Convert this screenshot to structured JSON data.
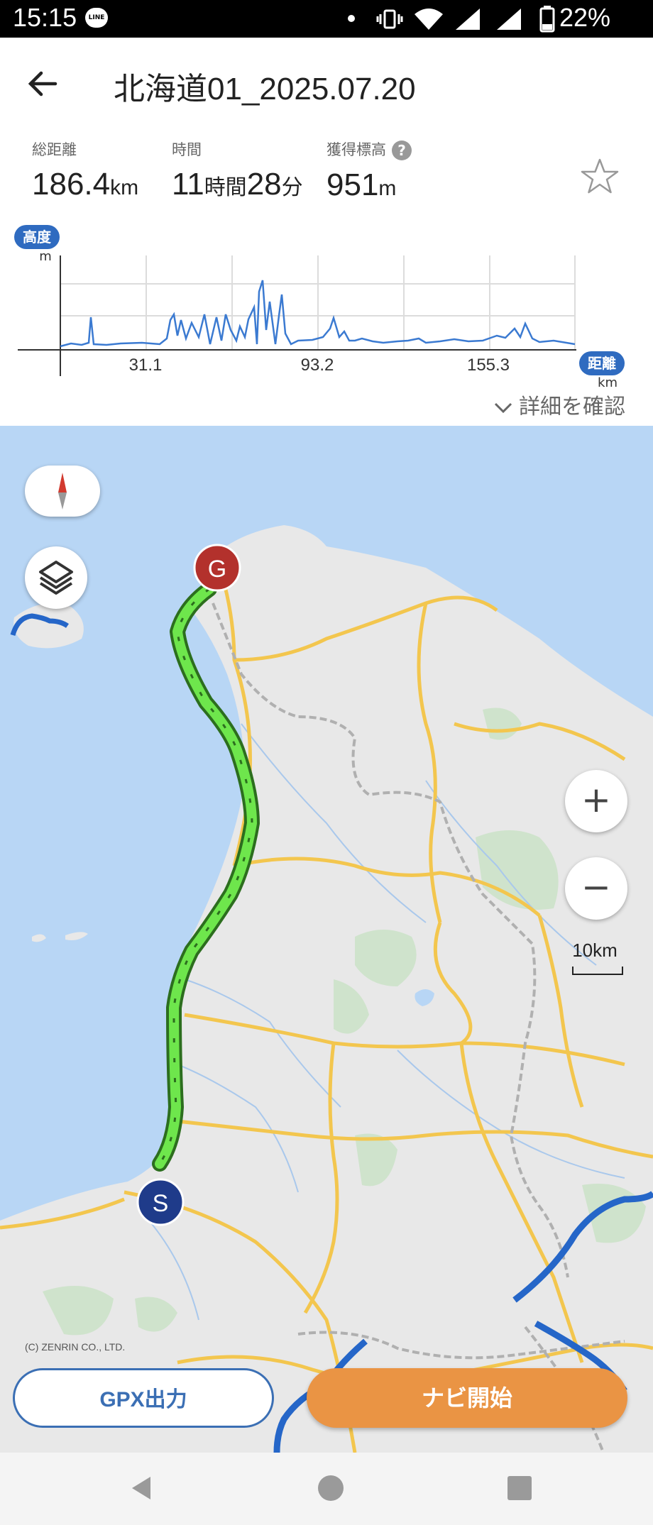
{
  "status_bar": {
    "time": "15:15",
    "notification_app": "LINE",
    "battery_percent": "22%"
  },
  "header": {
    "back_icon": "arrow-left-icon",
    "title": "北海道01_2025.07.20"
  },
  "stats": {
    "distance_label": "総距離",
    "distance_value": "186.4",
    "distance_unit": "km",
    "time_label": "時間",
    "time_hours": "11",
    "time_hours_unit": "時間",
    "time_minutes": "28",
    "time_minutes_unit": "分",
    "elevation_label": "獲得標高",
    "elevation_value": "951",
    "elevation_unit": "m",
    "help_icon": "?",
    "favorite_icon": "star-outline-icon"
  },
  "elevation_chart": {
    "y_badge": "高度",
    "y_unit": "m",
    "x_badge": "距離",
    "x_unit": "km",
    "x_ticks": [
      "31.1",
      "93.2",
      "155.3"
    ],
    "line_color": "#3b7ad1"
  },
  "details_link": "詳細を確認",
  "map": {
    "start_marker": "S",
    "goal_marker": "G",
    "zoom_in": "+",
    "zoom_out": "−",
    "scale": "10km",
    "copyright": "(C) ZENRIN CO., LTD.",
    "route_color": "#6ee64c",
    "water_color": "#b8d6f5",
    "land_color": "#e8e8e8"
  },
  "actions": {
    "gpx_export": "GPX出力",
    "start_navigation": "ナビ開始"
  },
  "nav_bar": {
    "back": "back-triangle-icon",
    "home": "home-circle-icon",
    "recents": "recents-square-icon"
  }
}
